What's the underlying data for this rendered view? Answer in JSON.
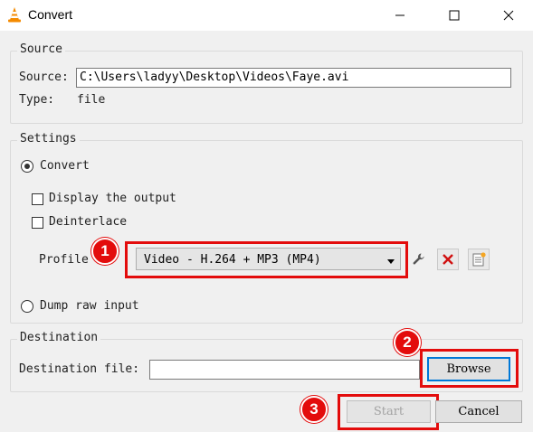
{
  "window": {
    "title": "Convert",
    "icon": "vlc-cone-icon",
    "controls": [
      "minimize-icon",
      "maximize-icon",
      "close-icon"
    ]
  },
  "source": {
    "legend": "Source",
    "source_label": "Source:",
    "source_value": "C:\\Users\\ladyy\\Desktop\\Videos\\Faye.avi",
    "type_label": "Type:",
    "type_value": "file"
  },
  "settings": {
    "legend": "Settings",
    "convert_label": "Convert",
    "convert_selected": true,
    "display_output_label": "Display the output",
    "display_output_checked": false,
    "deinterlace_label": "Deinterlace",
    "deinterlace_checked": false,
    "profile_label": "Profile",
    "profile_value": "Video - H.264 + MP3 (MP4)",
    "profile_tools": [
      "wrench-icon",
      "delete-x-icon",
      "new-profile-icon"
    ],
    "dump_raw_label": "Dump raw input",
    "dump_raw_selected": false
  },
  "destination": {
    "legend": "Destination",
    "file_label": "Destination file:",
    "file_value": "",
    "browse_label": "Browse"
  },
  "footer": {
    "start_label": "Start",
    "start_disabled": true,
    "cancel_label": "Cancel"
  },
  "annotations": {
    "badge_1": "1",
    "badge_2": "2",
    "badge_3": "3",
    "highlight_color": "#e30c0c"
  }
}
